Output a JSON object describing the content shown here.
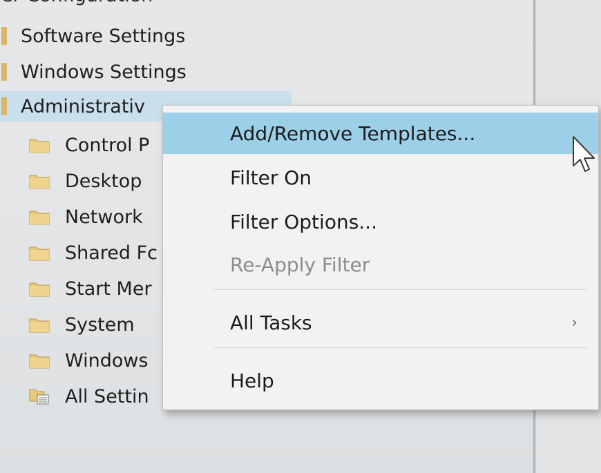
{
  "tree": {
    "top_partial_label": "er Configuration",
    "items": [
      {
        "label": "Software Settings",
        "icon": "folder-icon"
      },
      {
        "label": "Windows Settings",
        "icon": "folder-icon"
      },
      {
        "label": "Administrativ",
        "icon": "folder-icon",
        "selected": true
      },
      {
        "label": "Control P",
        "icon": "folder-icon"
      },
      {
        "label": "Desktop",
        "icon": "folder-icon"
      },
      {
        "label": "Network",
        "icon": "folder-icon"
      },
      {
        "label": "Shared Fc",
        "icon": "folder-icon"
      },
      {
        "label": "Start Mer",
        "icon": "folder-icon"
      },
      {
        "label": "System",
        "icon": "folder-icon"
      },
      {
        "label": "Windows",
        "icon": "folder-icon"
      },
      {
        "label": "All Settin",
        "icon": "settings-list-icon"
      }
    ]
  },
  "context_menu": {
    "items": [
      {
        "label": "Add/Remove Templates...",
        "highlighted": true
      },
      {
        "label": "Filter On"
      },
      {
        "label": "Filter Options..."
      },
      {
        "label": "Re-Apply Filter",
        "disabled": true
      },
      {
        "label": "All Tasks",
        "submenu_icon": "chevron-right-icon"
      },
      {
        "label": "Help"
      }
    ]
  },
  "colors": {
    "selection": "#c9dfec",
    "menu_highlight": "#9ccfe8",
    "folder": "#e8c87a"
  }
}
